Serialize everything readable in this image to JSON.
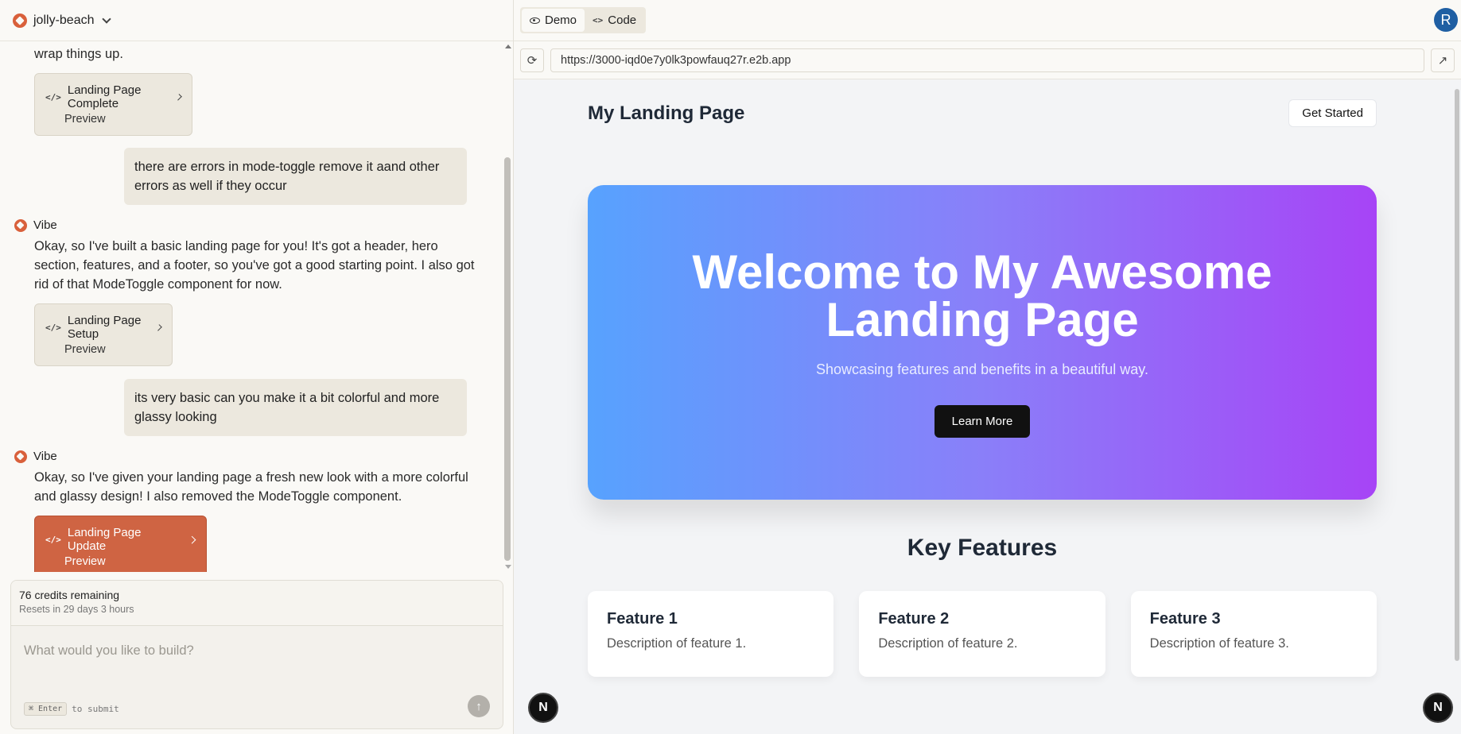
{
  "project": {
    "name": "jolly-beach"
  },
  "chat": {
    "messages": [
      {
        "type": "assistant-tail",
        "text": "wrap things up."
      },
      {
        "type": "fragment",
        "title": "Landing Page Complete",
        "sub": "Preview"
      },
      {
        "type": "user",
        "text": "there are errors in mode-toggle remove it aand other errors as well if they occur"
      },
      {
        "type": "assistant",
        "author": "Vibe",
        "text": "Okay, so I've built a basic landing page for you! It's got a header, hero section, features, and a footer, so you've got a good starting point. I also got rid of that ModeToggle component for now."
      },
      {
        "type": "fragment",
        "title": "Landing Page Setup",
        "sub": "Preview"
      },
      {
        "type": "user",
        "text": "its very basic can you make it a bit colorful and more glassy looking"
      },
      {
        "type": "assistant",
        "author": "Vibe",
        "text": "Okay, so I've given your landing page a fresh new look with a more colorful and glassy design! I also removed the ModeToggle component."
      },
      {
        "type": "fragment-active",
        "title": "Landing Page Update",
        "sub": "Preview"
      }
    ]
  },
  "composer": {
    "credits": "76 credits remaining",
    "resets": "Resets in 29 days 3 hours",
    "placeholder": "What would you like to build?",
    "kbd": "⌘ Enter",
    "hint": "to submit"
  },
  "viewer": {
    "tabs": {
      "demo": "Demo",
      "code": "Code"
    },
    "avatar": "R",
    "url": "https://3000-iqd0e7y0lk3powfauq27r.e2b.app"
  },
  "site": {
    "title": "My Landing Page",
    "cta": "Get Started",
    "hero": {
      "heading": "Welcome to My Awesome Landing Page",
      "subheading": "Showcasing features and benefits in a beautiful way.",
      "button": "Learn More",
      "gradient": [
        "#57a2fe",
        "#a744f6"
      ]
    },
    "features_title": "Key Features",
    "features": [
      {
        "title": "Feature 1",
        "desc": "Description of feature 1."
      },
      {
        "title": "Feature 2",
        "desc": "Description of feature 2."
      },
      {
        "title": "Feature 3",
        "desc": "Description of feature 3."
      }
    ]
  },
  "badge": "N",
  "colors": {
    "accent": "#cf6443",
    "avatar": "#1f5fa3"
  }
}
